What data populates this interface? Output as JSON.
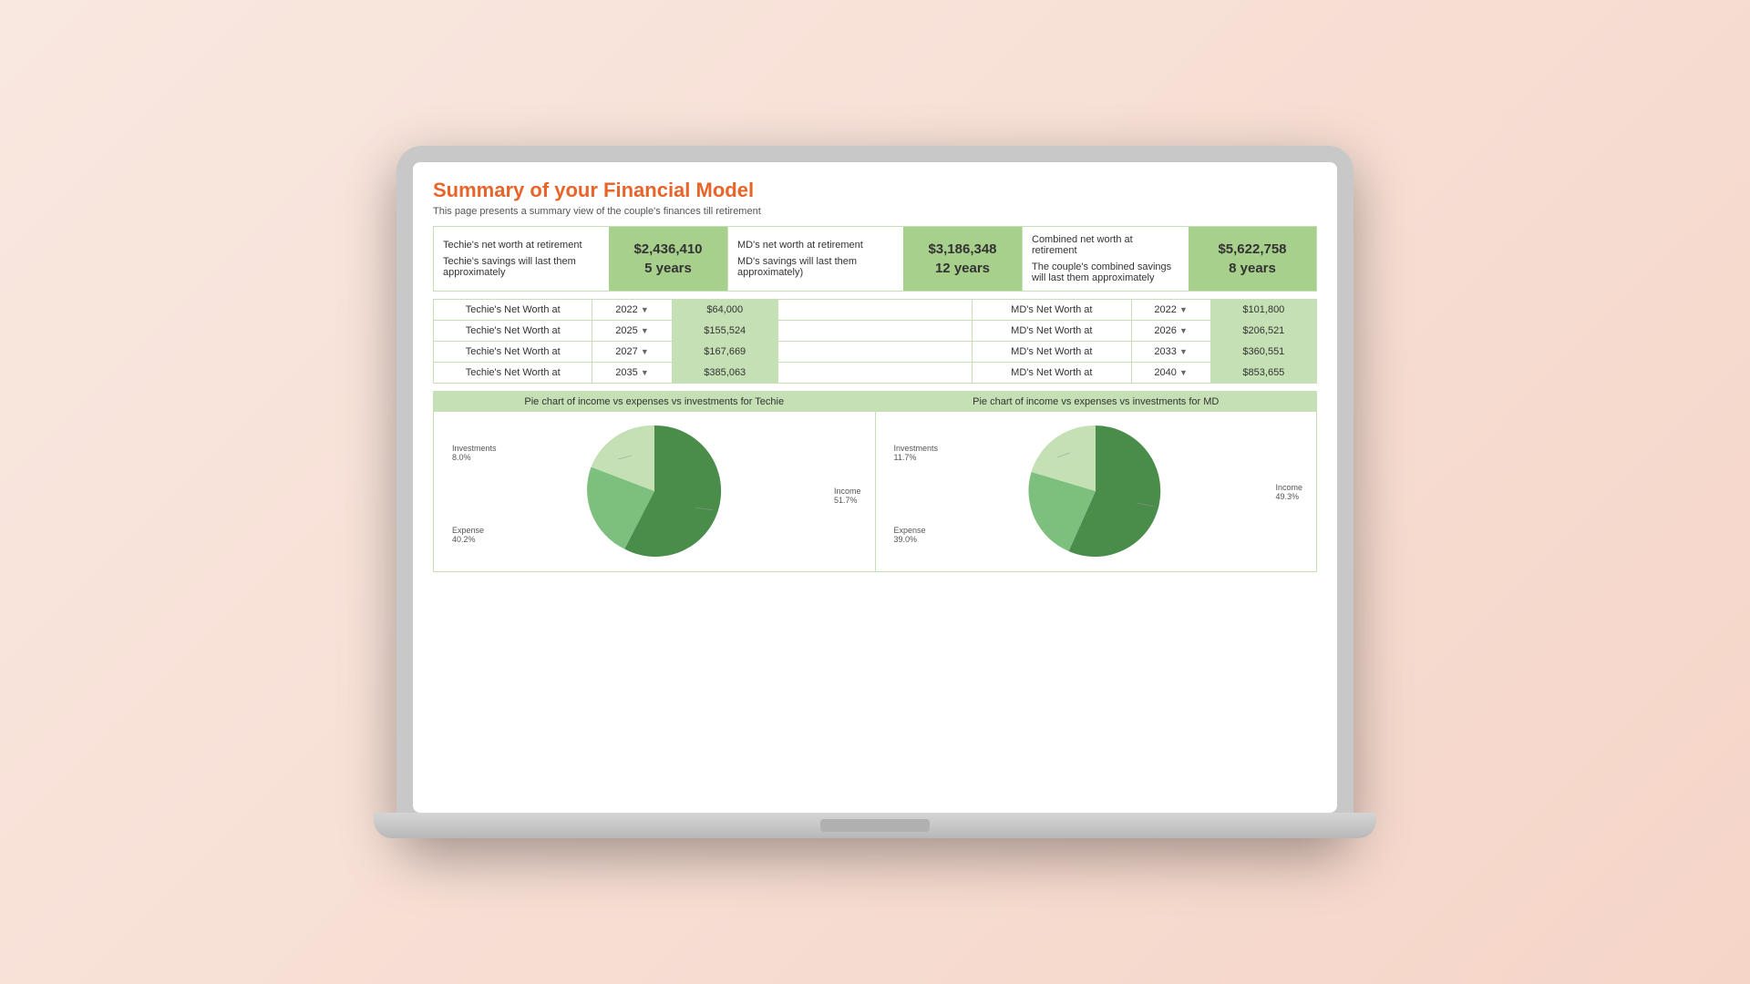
{
  "page": {
    "title": "Summary of your Financial Model",
    "subtitle": "This page presents a summary view of the couple's finances till retirement"
  },
  "summary_cards": [
    {
      "label_main": "Techie's net worth at retirement",
      "label_sub": "Techie's savings will last them approximately",
      "value": "$2,436,410",
      "years": "5 years"
    },
    {
      "label_main": "MD's net worth at retirement",
      "label_sub": "MD's savings will last them approximately)",
      "value": "$3,186,348",
      "years": "12 years"
    },
    {
      "label_main": "Combined net worth at retirement",
      "label_sub": "The couple's combined savings will last them approximately",
      "value": "$5,622,758",
      "years": "8 years"
    }
  ],
  "techie_rows": [
    {
      "label": "Techie's Net Worth at",
      "year": "2022",
      "value": "$64,000"
    },
    {
      "label": "Techie's Net Worth at",
      "year": "2025",
      "value": "$155,524"
    },
    {
      "label": "Techie's Net Worth at",
      "year": "2027",
      "value": "$167,669"
    },
    {
      "label": "Techie's Net Worth at",
      "year": "2035",
      "value": "$385,063"
    }
  ],
  "md_rows": [
    {
      "label": "MD's Net Worth at",
      "year": "2022",
      "value": "$101,800"
    },
    {
      "label": "MD's Net Worth at",
      "year": "2026",
      "value": "$206,521"
    },
    {
      "label": "MD's Net Worth at",
      "year": "2033",
      "value": "$360,551"
    },
    {
      "label": "MD's Net Worth at",
      "year": "2040",
      "value": "$853,655"
    }
  ],
  "pie_charts": [
    {
      "title": "Pie chart of income vs expenses vs investments for Techie",
      "segments": [
        {
          "label": "Income",
          "pct": 51.7,
          "color": "#4a8c4a"
        },
        {
          "label": "Expense",
          "pct": 40.2,
          "color": "#7dbf7d"
        },
        {
          "label": "Investments",
          "pct": 8.0,
          "color": "#c5e0b4"
        }
      ],
      "labels": [
        {
          "name": "Investments",
          "pct": "8.0%",
          "side": "left"
        },
        {
          "name": "Expense",
          "pct": "40.2%",
          "side": "left"
        },
        {
          "name": "Income",
          "pct": "51.7%",
          "side": "right"
        }
      ]
    },
    {
      "title": "Pie chart of income vs expenses vs investments for MD",
      "segments": [
        {
          "label": "Income",
          "pct": 49.3,
          "color": "#4a8c4a"
        },
        {
          "label": "Expense",
          "pct": 39.0,
          "color": "#7dbf7d"
        },
        {
          "label": "Investments",
          "pct": 11.7,
          "color": "#c5e0b4"
        }
      ],
      "labels": [
        {
          "name": "Investments",
          "pct": "11.7%",
          "side": "left"
        },
        {
          "name": "Expense",
          "pct": "39.0%",
          "side": "left"
        },
        {
          "name": "Income",
          "pct": "49.3%",
          "side": "right"
        }
      ]
    }
  ],
  "colors": {
    "accent": "#e8642a",
    "green_bg": "#a8d08d",
    "green_light": "#c5e0b4",
    "green_dark": "#4a8c4a",
    "green_mid": "#7dbf7d"
  }
}
